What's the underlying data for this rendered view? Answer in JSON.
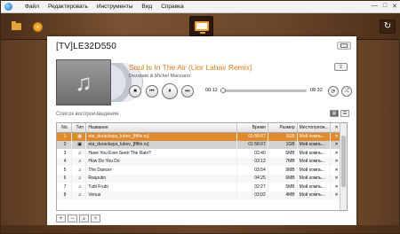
{
  "menu": {
    "items": [
      "Файл",
      "Редактировать",
      "Инструменты",
      "Вид",
      "Справка"
    ]
  },
  "window_controls": [
    "—",
    "□",
    "✕"
  ],
  "toolbar": {
    "open_icon": "folder-icon",
    "disc_icon": "disc-icon",
    "device_icon": "tv-icon",
    "refresh_icon": "refresh-icon",
    "refresh_glyph": "↻"
  },
  "device": {
    "name": "[TV]LE32D550"
  },
  "now_playing": {
    "title": "Soul Is In The Air (Lior Lahav Remix)",
    "artist": "Dezarate & Michel Manzano",
    "elapsed": "00:12",
    "total": "08:32",
    "progress": 0.02
  },
  "controls": {
    "stop": "■",
    "prev": "⏮",
    "pause": "⏸",
    "next": "⏭",
    "repeat": "⟳",
    "shuffle": "⤮"
  },
  "playlist": {
    "label": "Список воспроизведения",
    "columns": [
      "No.",
      "Тип",
      "Название",
      "Время",
      "Размер",
      "Местополож...",
      "✕"
    ],
    "rows": [
      {
        "no": "1",
        "type": "video",
        "name": "eta_durackaya_lubov_[ftfile.ru]",
        "time": "01:58:07",
        "size": "1GB",
        "loc": "Мой компь...",
        "state": "playing"
      },
      {
        "no": "2",
        "type": "video",
        "name": "eta_durackaya_lubov_[ftfile.ru]",
        "time": "01:58:07",
        "size": "1GB",
        "loc": "Мой компь...",
        "state": "selected"
      },
      {
        "no": "3",
        "type": "audio",
        "name": "Have You Ever Seen The Rain?",
        "time": "02:40",
        "size": "6MB",
        "loc": "Мой компь...",
        "state": ""
      },
      {
        "no": "4",
        "type": "audio",
        "name": "How Do You Do",
        "time": "03:12",
        "size": "7MB",
        "loc": "Мой компь...",
        "state": ""
      },
      {
        "no": "5",
        "type": "audio",
        "name": "The Dancer",
        "time": "03:54",
        "size": "9MB",
        "loc": "Мой компь...",
        "state": ""
      },
      {
        "no": "6",
        "type": "audio",
        "name": "Rasputin",
        "time": "04:25",
        "size": "6MB",
        "loc": "Мой компь...",
        "state": ""
      },
      {
        "no": "7",
        "type": "audio",
        "name": "Tutti Frutti",
        "time": "02:27",
        "size": "5MB",
        "loc": "Мой компь...",
        "state": ""
      },
      {
        "no": "8",
        "type": "audio",
        "name": "Venus",
        "time": "03:02",
        "size": "4MB",
        "loc": "Мой компь...",
        "state": ""
      }
    ],
    "remove_glyph": "✕"
  },
  "playlist_buttons": [
    "+",
    "−",
    "▲",
    "▼"
  ],
  "view_buttons": [
    "▤",
    "☰"
  ],
  "colors": {
    "accent": "#e07b10",
    "playing_row": "#e08a2a",
    "wood": "#6b4428"
  }
}
